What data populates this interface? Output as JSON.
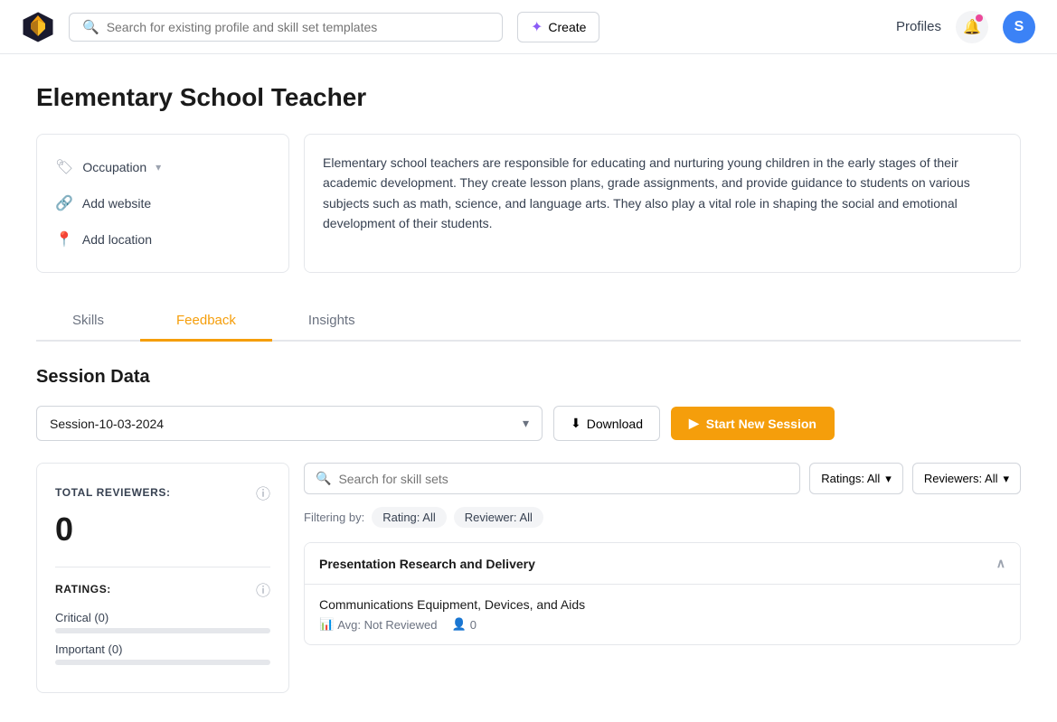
{
  "header": {
    "search_placeholder": "Search for existing profile and skill set templates",
    "create_label": "Create",
    "profiles_label": "Profiles",
    "avatar_letter": "S"
  },
  "page": {
    "title": "Elementary School Teacher"
  },
  "profile_left": {
    "occupation_label": "Occupation",
    "add_website_label": "Add website",
    "add_location_label": "Add location"
  },
  "profile_desc": "Elementary school teachers are responsible for educating and nurturing young children in the early stages of their academic development. They create lesson plans, grade assignments, and provide guidance to students on various subjects such as math, science, and language arts. They also play a vital role in shaping the social and emotional development of their students.",
  "tabs": [
    {
      "label": "Skills",
      "active": false
    },
    {
      "label": "Feedback",
      "active": true
    },
    {
      "label": "Insights",
      "active": false
    }
  ],
  "session_data": {
    "title": "Session Data",
    "session_value": "Session-10-03-2024",
    "download_label": "Download",
    "start_session_label": "Start New Session"
  },
  "stats": {
    "total_reviewers_label": "TOTAL REVIEWERS:",
    "total_reviewers_value": "0",
    "ratings_label": "RATINGS:",
    "critical_label": "Critical (0)",
    "important_label": "Important (0)"
  },
  "skills_search": {
    "placeholder": "Search for skill sets"
  },
  "filter": {
    "label": "Filtering by:",
    "ratings_filter": "Ratings: All",
    "reviewers_filter": "Reviewers: All",
    "chip_rating": "Rating: All",
    "chip_reviewer": "Reviewer: All"
  },
  "skill_category": {
    "name": "Presentation Research and Delivery",
    "skill_name": "Communications Equipment, Devices, and Aids",
    "avg_label": "Avg: Not Reviewed",
    "reviewers_count": "0"
  }
}
